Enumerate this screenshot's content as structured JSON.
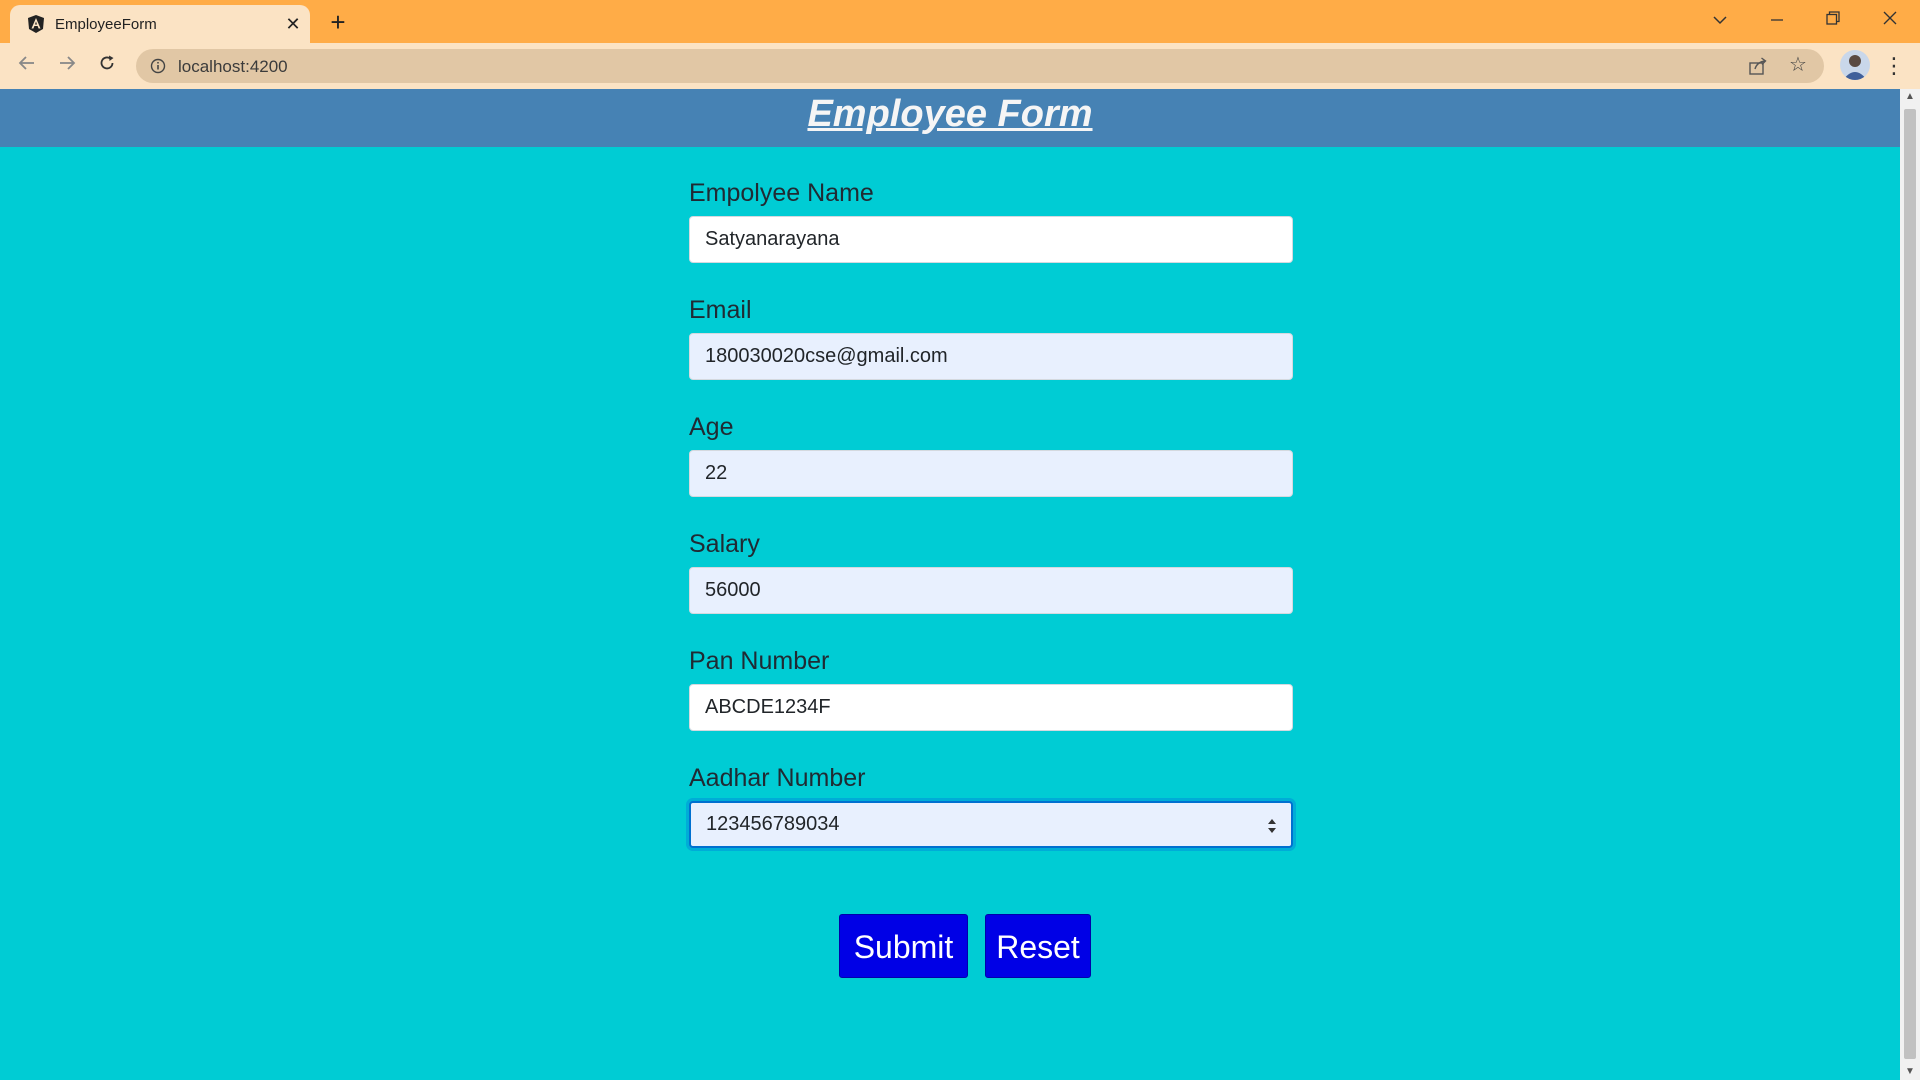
{
  "browser": {
    "tab": {
      "title": "EmployeeForm",
      "favicon": "angular-icon",
      "close_symbol": "✕"
    },
    "new_tab_symbol": "+",
    "window_controls": [
      "chevron-down-icon",
      "minimize-icon",
      "restore-icon",
      "close-icon"
    ],
    "address": {
      "url": "localhost:4200"
    }
  },
  "page": {
    "title": "Employee Form"
  },
  "form": {
    "fields": [
      {
        "label": "Empolyee Name",
        "value": "Satyanarayana",
        "state": "default"
      },
      {
        "label": "Email",
        "value": "180030020cse@gmail.com",
        "state": "autofilled"
      },
      {
        "label": "Age",
        "value": "22",
        "state": "autofilled"
      },
      {
        "label": "Salary",
        "value": "56000",
        "state": "autofilled"
      },
      {
        "label": "Pan Number",
        "value": "ABCDE1234F",
        "state": "default"
      },
      {
        "label": "Aadhar Number",
        "value": "123456789034",
        "state": "focused"
      }
    ],
    "buttons": {
      "submit": "Submit",
      "reset": "Reset"
    }
  },
  "colors": {
    "titlebar": "#ffac47",
    "toolbar": "#fbe3c4",
    "header": "#4682b4",
    "page_background": "#00ccd4",
    "button": "#0000e6"
  }
}
